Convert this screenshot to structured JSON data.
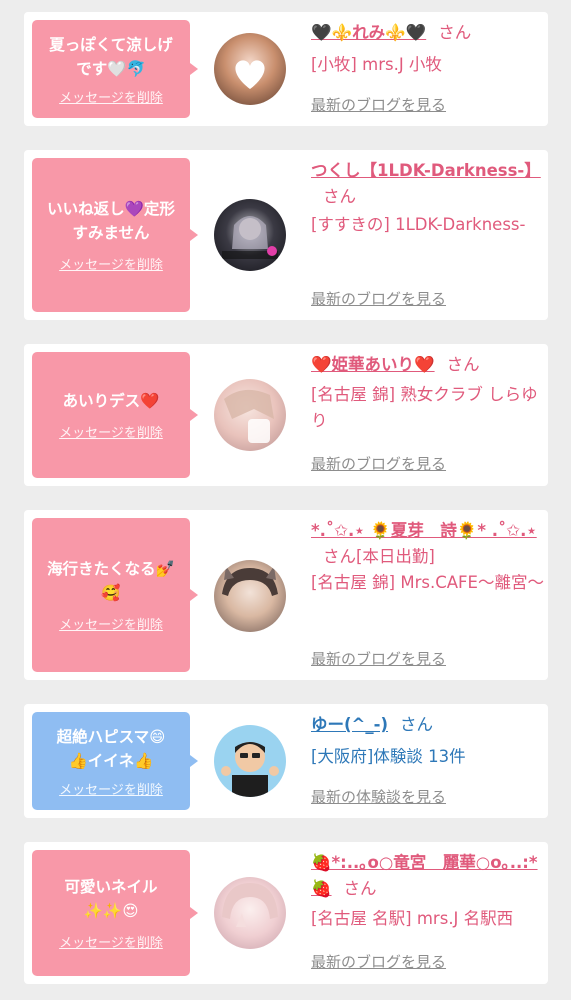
{
  "colors": {
    "page_bg": "#ededed",
    "card_bg": "#ffffff",
    "bubble_pink": "#f898a8",
    "bubble_blue": "#8fbdf2",
    "name_pink": "#e05a7c",
    "name_blue": "#2e78b8",
    "link_gray": "#8d8d8d"
  },
  "cards": [
    {
      "message": "夏っぽくて涼しげ\nです🤍🐬",
      "delete_label": "メッセージを削除",
      "name": "🖤⚜️れみ⚜️🖤",
      "honorific": "さん",
      "location": "[小牧] mrs.J 小牧",
      "blog_link": "最新のブログを見る"
    },
    {
      "message": "いいね返し💜定形\nすみません",
      "delete_label": "メッセージを削除",
      "name": "つくし【1LDK-Darkness-】",
      "honorific": "さん",
      "location": "[すすきの] 1LDK-Darkness-",
      "blog_link": "最新のブログを見る"
    },
    {
      "message": "あいりデス❤️",
      "delete_label": "メッセージを削除",
      "name": "❤️姫華あいり❤️",
      "honorific": "さん",
      "location": "[名古屋 錦] 熟女クラブ しらゆり",
      "blog_link": "最新のブログを見る"
    },
    {
      "message": "海行きたくなる💅\n🥰",
      "delete_label": "メッセージを削除",
      "name": "*.˚✩.⋆ 🌻夏芽　詩🌻* .˚✩.⋆",
      "honorific": "さん",
      "status": "[本日出勤]",
      "location": "[名古屋 錦] Mrs.CAFE〜離宮〜",
      "blog_link": "最新のブログを見る"
    },
    {
      "message": "超絶ハピスマ😄\n👍イイネ👍",
      "delete_label": "メッセージを削除",
      "name": "ゆー(^_-)",
      "honorific": "さん",
      "location": "[大阪府]体験談 13件",
      "blog_link": "最新の体験談を見る"
    },
    {
      "message": "可愛いネイル\n✨✨😍",
      "delete_label": "メッセージを削除",
      "name": "🍓*:..｡o○竜宮　麗華○o｡..:*🍓",
      "honorific": "さん",
      "location": "[名古屋 名駅] mrs.J 名駅西",
      "blog_link": "最新のブログを見る"
    }
  ]
}
